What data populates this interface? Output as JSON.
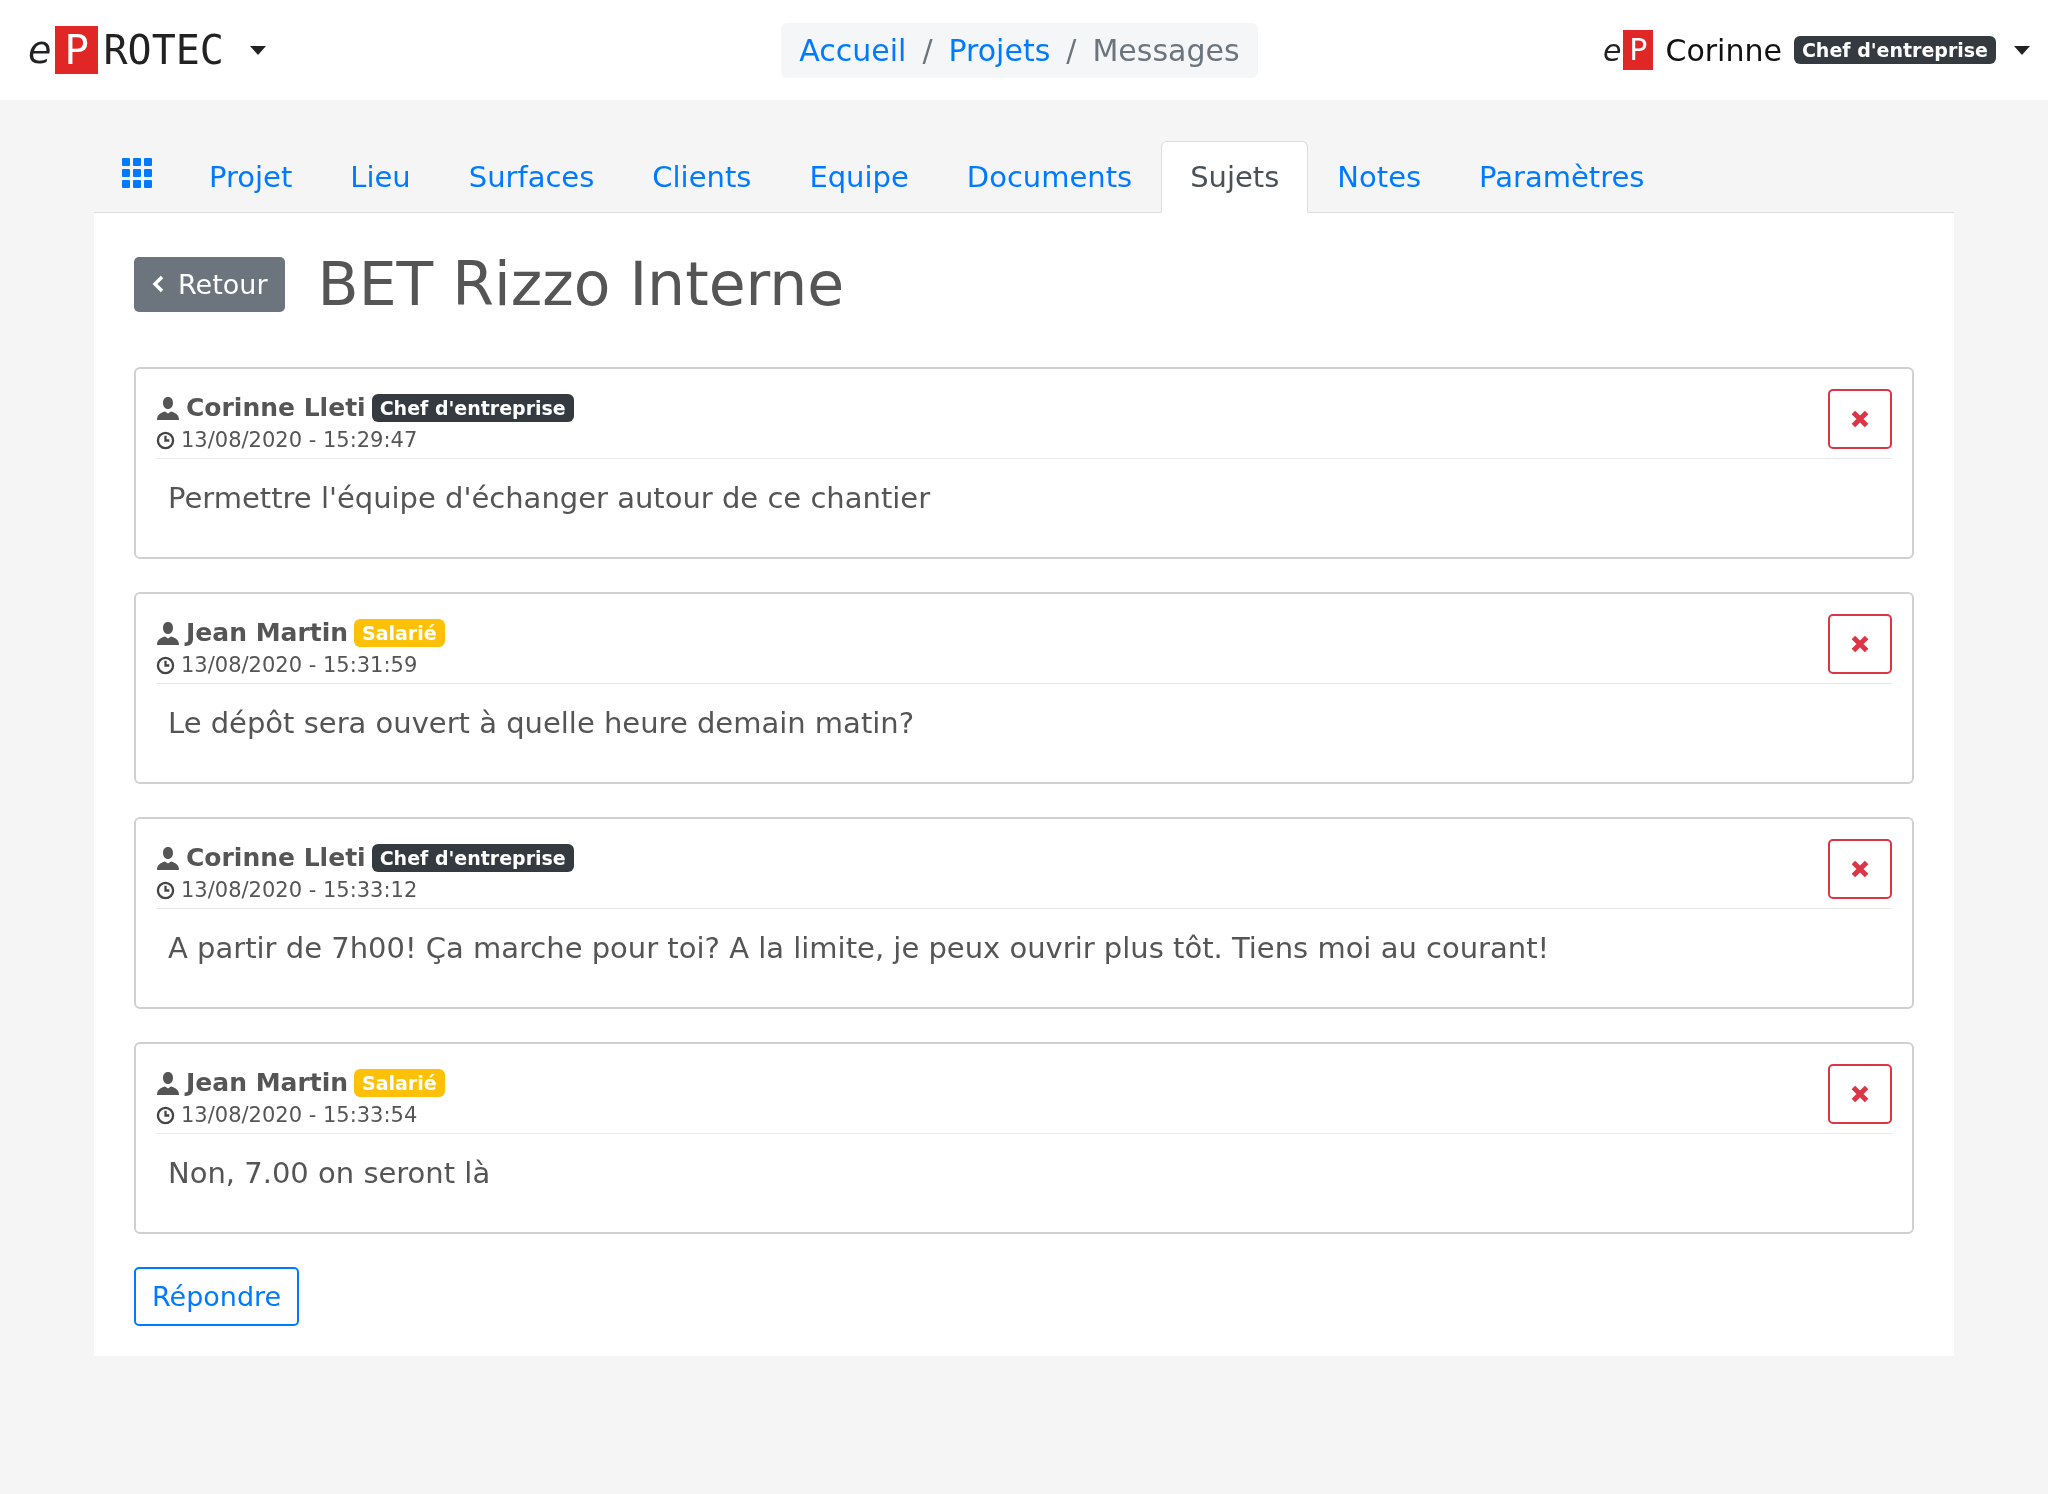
{
  "brand": {
    "prefix": "e",
    "mark": "P",
    "name": "ROTEC"
  },
  "breadcrumb": [
    {
      "label": "Accueil",
      "kind": "link"
    },
    {
      "label": "Projets",
      "kind": "link"
    },
    {
      "label": "Messages",
      "kind": "current"
    }
  ],
  "breadcrumb_separator": "/",
  "user": {
    "logo_prefix": "e",
    "logo_mark": "P",
    "name": "Corinne",
    "role": "Chef d'entreprise"
  },
  "tabs": [
    {
      "label": "Projet",
      "selected": false
    },
    {
      "label": "Lieu",
      "selected": false
    },
    {
      "label": "Surfaces",
      "selected": false
    },
    {
      "label": "Clients",
      "selected": false
    },
    {
      "label": "Equipe",
      "selected": false
    },
    {
      "label": "Documents",
      "selected": false
    },
    {
      "label": "Sujets",
      "selected": true
    },
    {
      "label": "Notes",
      "selected": false
    },
    {
      "label": "Paramètres",
      "selected": false
    }
  ],
  "back_button": "Retour",
  "title": "BET Rizzo Interne",
  "messages": [
    {
      "author": "Corinne Lleti",
      "role": "Chef d'entreprise",
      "color": "#343a40",
      "date": "13/08/2020 - 15:29:47",
      "text": "Permettre l'équipe d'échanger autour de ce chantier"
    },
    {
      "author": "Jean Martin",
      "role": "Salarié",
      "color": "#ffc107",
      "date": "13/08/2020 - 15:31:59",
      "text": "Le dépôt sera ouvert à quelle heure demain matin?"
    },
    {
      "author": "Corinne Lleti",
      "role": "Chef d'entreprise",
      "color": "#343a40",
      "date": "13/08/2020 - 15:33:12",
      "text": "A partir de 7h00! Ça marche pour toi? A la limite, je peux ouvrir plus tôt. Tiens moi au courant!"
    },
    {
      "author": "Jean Martin",
      "role": "Salarié",
      "color": "#ffc107",
      "date": "13/08/2020 - 15:33:54",
      "text": "Non, 7.00 on seront là"
    }
  ],
  "reply_button": "Répondre"
}
